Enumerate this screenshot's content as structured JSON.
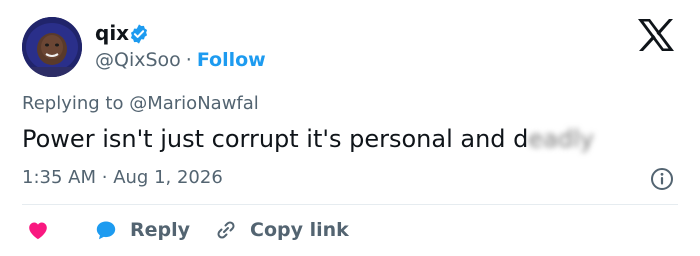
{
  "author": {
    "name": "qix",
    "handle": "@QixSoo",
    "separator": "·",
    "follow_label": "Follow"
  },
  "tweet": {
    "replying_prefix": "Replying to",
    "replying_to": "@MarioNawfal",
    "text": "Power isn't just corrupt it's personal and d",
    "text_blurred": "eadly",
    "time": "1:35 AM",
    "time_separator": "·",
    "date": "Aug 1, 2026"
  },
  "actions": {
    "reply_label": "Reply",
    "copy_link_label": "Copy link"
  },
  "icons": {
    "like": "heart-icon",
    "reply": "speech-bubble-icon",
    "copy": "link-icon",
    "info": "info-icon",
    "brand": "x-logo-icon",
    "verified": "verified-badge-icon"
  },
  "colors": {
    "accent": "#1d9bf0",
    "like": "#f91880",
    "muted": "#536471",
    "text": "#0f1419"
  }
}
